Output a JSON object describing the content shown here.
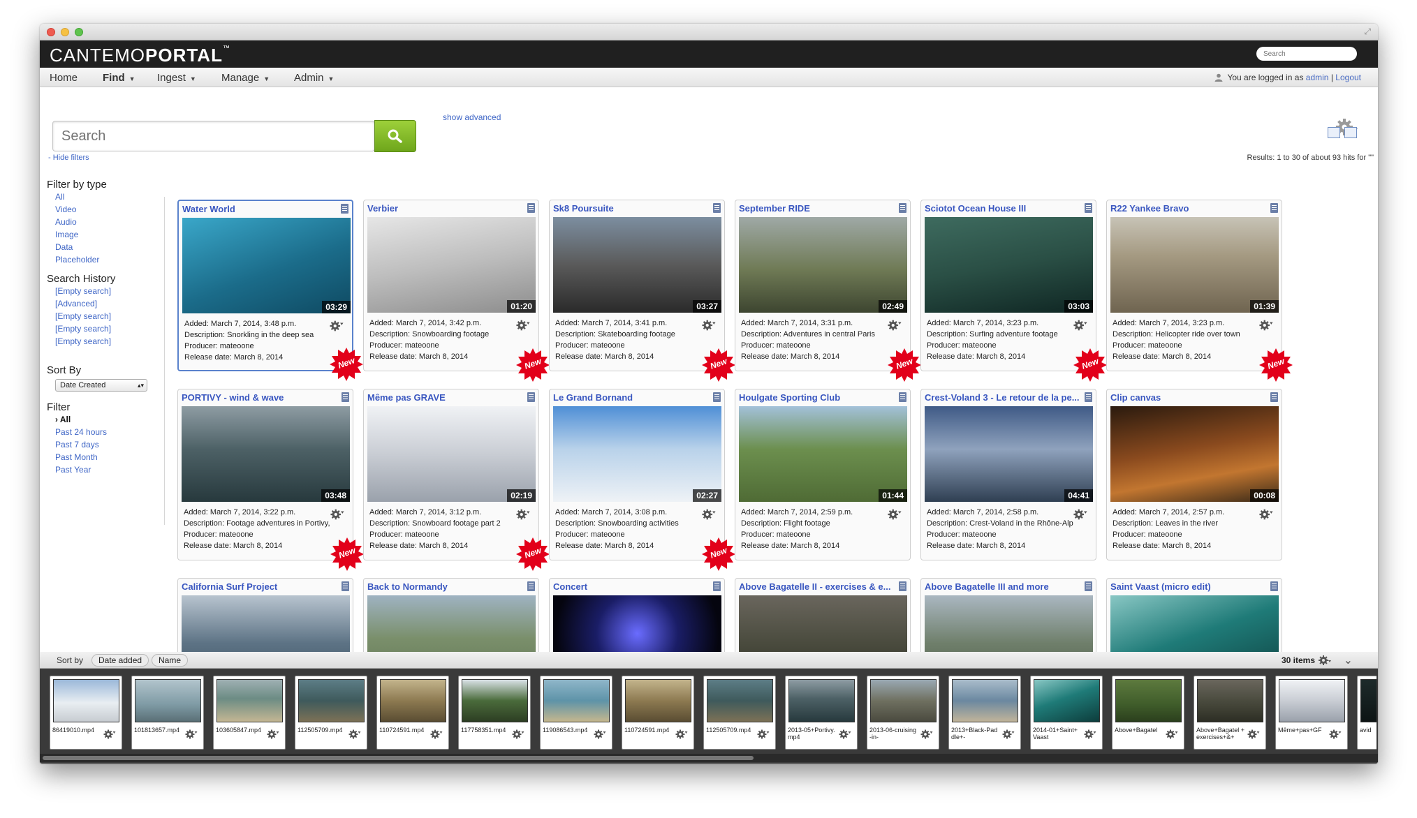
{
  "app": {
    "brand_light": "CANTEMO",
    "brand_bold": "PORTAL",
    "tm": "™",
    "top_search_placeholder": "Search"
  },
  "nav": {
    "items": [
      {
        "label": "Home",
        "caret": false
      },
      {
        "label": "Find",
        "caret": true
      },
      {
        "label": "Ingest",
        "caret": true
      },
      {
        "label": "Manage",
        "caret": true
      },
      {
        "label": "Admin",
        "caret": true
      }
    ],
    "login_prefix": "You are logged in as",
    "user": "admin",
    "separator": "|",
    "logout": "Logout"
  },
  "search": {
    "placeholder": "Search",
    "show_advanced": "show advanced"
  },
  "toolbar": {
    "hide_filters": "- Hide filters",
    "results": "Results: 1 to 30 of about 93 hits for \"\""
  },
  "sidebar": {
    "filter_type_title": "Filter by type",
    "types": [
      "All",
      "Video",
      "Audio",
      "Image",
      "Data",
      "Placeholder"
    ],
    "history_title": "Search History",
    "history": [
      "[Empty search]",
      "[Advanced]",
      "[Empty search]",
      "[Empty search]",
      "[Empty search]"
    ],
    "sort_title": "Sort By",
    "sort_value": "Date Created",
    "filter_title": "Filter",
    "filters": [
      "› All",
      "Past 24 hours",
      "Past 7 days",
      "Past Month",
      "Past Year"
    ]
  },
  "cards": [
    {
      "title": "Water World",
      "duration": "03:29",
      "added": "Added: March 7, 2014, 3:48 p.m.",
      "description": "Description: Snorkling in the deep sea",
      "producer": "Producer: mateoone",
      "release": "Release date: March 8, 2014",
      "new": true,
      "selected": true,
      "bg": "linear-gradient(160deg,#3aa7c9,#1b6c8a 55%,#0f4a62)"
    },
    {
      "title": "Verbier",
      "duration": "01:20",
      "added": "Added: March 7, 2014, 3:42 p.m.",
      "description": "Description: Snowboarding footage",
      "producer": "Producer: mateoone",
      "release": "Release date: March 8, 2014",
      "new": true,
      "selected": false,
      "bg": "linear-gradient(170deg,#e6e6e6,#bdbdbd 50%,#8d8d8d)"
    },
    {
      "title": "Sk8 Poursuite",
      "duration": "03:27",
      "added": "Added: March 7, 2014, 3:41 p.m.",
      "description": "Description: Skateboarding footage",
      "producer": "Producer: mateoone",
      "release": "Release date: March 8, 2014",
      "new": true,
      "selected": false,
      "bg": "linear-gradient(180deg,#7c8ea0,#5a5a5a 50%,#2a2a2a)"
    },
    {
      "title": "September RIDE",
      "duration": "02:49",
      "added": "Added: March 7, 2014, 3:31 p.m.",
      "description": "Description: Adventures in central Paris",
      "producer": "Producer: mateoone",
      "release": "Release date: March 8, 2014",
      "new": true,
      "selected": false,
      "bg": "linear-gradient(180deg,#9fa9a6,#6f7a55 55%,#3d4530)"
    },
    {
      "title": "Sciotot Ocean House III",
      "duration": "03:03",
      "added": "Added: March 7, 2014, 3:23 p.m.",
      "description": "Description: Surfing adventure footage",
      "producer": "Producer: mateoone",
      "release": "Release date: March 8, 2014",
      "new": true,
      "selected": false,
      "bg": "linear-gradient(170deg,#3e6b5f,#2a4f45 50%,#0f2623)"
    },
    {
      "title": "R22 Yankee Bravo",
      "duration": "01:39",
      "added": "Added: March 7, 2014, 3:23 p.m.",
      "description": "Description: Helicopter ride over town",
      "producer": "Producer: mateoone",
      "release": "Release date: March 8, 2014",
      "new": true,
      "selected": false,
      "bg": "linear-gradient(180deg,#c7c3b6,#a59a82 40%,#6f6450)"
    },
    {
      "title": "PORTIVY - wind & wave",
      "duration": "03:48",
      "added": "Added: March 7, 2014, 3:22 p.m.",
      "description": "Description: Footage adventures in Portivy,",
      "producer": "Producer: mateoone",
      "release": "Release date: March 8, 2014",
      "new": true,
      "selected": false,
      "bg": "linear-gradient(180deg,#8e9ca3,#4d6166 45%,#27393d)"
    },
    {
      "title": "Même pas GRAVE",
      "duration": "02:19",
      "added": "Added: March 7, 2014, 3:12 p.m.",
      "description": "Description: Snowboard footage part 2",
      "producer": "Producer: mateoone",
      "release": "Release date: March 8, 2014",
      "new": true,
      "selected": false,
      "bg": "linear-gradient(180deg,#f0f2f5,#c9cdd4 50%,#9aa1ab)"
    },
    {
      "title": "Le Grand Bornand",
      "duration": "02:27",
      "added": "Added: March 7, 2014, 3:08 p.m.",
      "description": "Description: Snowboarding activities",
      "producer": "Producer: mateoone",
      "release": "Release date: March 8, 2014",
      "new": true,
      "selected": false,
      "bg": "linear-gradient(180deg,#4f8fd6,#b9d2ea 45%,#eef2f6)"
    },
    {
      "title": "Houlgate Sporting Club",
      "duration": "01:44",
      "added": "Added: March 7, 2014, 2:59 p.m.",
      "description": "Description: Flight footage",
      "producer": "Producer: mateoone",
      "release": "Release date: March 8, 2014",
      "new": false,
      "selected": false,
      "bg": "linear-gradient(180deg,#a3c1d9,#6c8f4e 45%,#4f6b35)"
    },
    {
      "title": "Crest-Voland 3 - Le retour de la pe...",
      "duration": "04:41",
      "added": "Added: March 7, 2014, 2:58 p.m.",
      "description": "Description: Crest-Voland in the Rhône-Alp",
      "producer": "Producer: mateoone",
      "release": "Release date: March 8, 2014",
      "new": false,
      "selected": false,
      "bg": "linear-gradient(180deg,#3f5a86,#8fa2bd 45%,#2f3f52)"
    },
    {
      "title": "Clip canvas",
      "duration": "00:08",
      "added": "Added: March 7, 2014, 2:57 p.m.",
      "description": "Description: Leaves in the river",
      "producer": "Producer: mateoone",
      "release": "Release date: March 8, 2014",
      "new": false,
      "selected": false,
      "bg": "linear-gradient(170deg,#2a1a0e,#8a4a1e 45%,#c27630 70%,#3a2a18)"
    },
    {
      "title": "California Surf Project",
      "duration": "",
      "added": "",
      "description": "",
      "producer": "",
      "release": "",
      "new": false,
      "selected": false,
      "bg": "linear-gradient(180deg,#b8c4cf,#5d7385 50%,#3b4e5e)"
    },
    {
      "title": "Back to Normandy",
      "duration": "",
      "added": "",
      "description": "",
      "producer": "",
      "release": "",
      "new": false,
      "selected": false,
      "bg": "linear-gradient(180deg,#9fb3c2,#7a8f6b 45%,#5f7452)"
    },
    {
      "title": "Concert",
      "duration": "",
      "added": "",
      "description": "",
      "producer": "",
      "release": "",
      "new": false,
      "selected": false,
      "bg": "radial-gradient(circle at 50% 40%,#6a6cff,#1a1d66 40%,#05050f 80%)"
    },
    {
      "title": "Above Bagatelle II - exercises & e...",
      "duration": "",
      "added": "",
      "description": "",
      "producer": "",
      "release": "",
      "new": false,
      "selected": false,
      "bg": "linear-gradient(180deg,#6a665d,#4a4b3e 50%,#2d2e24)"
    },
    {
      "title": "Above Bagatelle III and more",
      "duration": "",
      "added": "",
      "description": "",
      "producer": "",
      "release": "",
      "new": false,
      "selected": false,
      "bg": "linear-gradient(180deg,#aab7c1,#6f7f6b 50%,#4d5a48)"
    },
    {
      "title": "Saint Vaast (micro edit)",
      "duration": "",
      "added": "",
      "description": "",
      "producer": "",
      "release": "",
      "new": false,
      "selected": false,
      "bg": "linear-gradient(160deg,#89c7c4,#1f7b78 45%,#0d3d3c)"
    }
  ],
  "basket": {
    "sort_by": "Sort by",
    "sort_options": [
      "Date added",
      "Name"
    ],
    "count": "30 items",
    "items": [
      {
        "name": "86419010.mp4",
        "bg": "linear-gradient(180deg,#9bb8d9,#e9eef2 55%,#c7ccd1)"
      },
      {
        "name": "101813657.mp4",
        "bg": "linear-gradient(180deg,#b2c4cc,#7e9aa4 60%,#5a6f76)"
      },
      {
        "name": "103605847.mp4",
        "bg": "linear-gradient(180deg,#9fb0b3,#6c8c84 45%,#c4b693)"
      },
      {
        "name": "112505709.mp4",
        "bg": "linear-gradient(180deg,#5d7d86,#3f5a5c 50%,#7c7156)"
      },
      {
        "name": "110724591.mp4",
        "bg": "linear-gradient(180deg,#c3b48c,#8d7a51 50%,#5a4d33)"
      },
      {
        "name": "117758351.mp4",
        "bg": "linear-gradient(180deg,#d9e1e6,#4a6b3b 50%,#2d3e23)"
      },
      {
        "name": "119086543.mp4",
        "bg": "linear-gradient(180deg,#8fb6c9,#5e93a8 50%,#c5b78e)"
      },
      {
        "name": "110724591.mp4",
        "bg": "linear-gradient(180deg,#c3b48c,#8d7a51 50%,#5a4d33)"
      },
      {
        "name": "112505709.mp4",
        "bg": "linear-gradient(180deg,#5d7d86,#3f5a5c 50%,#7c7156)"
      },
      {
        "name": "2013-05+Portivy.mp4",
        "bg": "linear-gradient(180deg,#8e9ca3,#4d6166 45%,#27393d)"
      },
      {
        "name": "2013-06-cruising-in-",
        "bg": "linear-gradient(180deg,#9aa9b3,#6f7060 50%,#4a4a3f)"
      },
      {
        "name": "2013+Black-Paddle+-",
        "bg": "linear-gradient(180deg,#a9bccb,#6b88a0 50%,#c1b49a)"
      },
      {
        "name": "2014-01+Saint+Vaast",
        "bg": "linear-gradient(160deg,#89c7c4,#1f7b78 45%,#0d3d3c)"
      },
      {
        "name": "Above+Bagatel",
        "bg": "linear-gradient(180deg,#5d7a3e,#3f5c2a 60%,#2b3f1d)"
      },
      {
        "name": "Above+Bagatel +exercises+&+",
        "bg": "linear-gradient(180deg,#6a665d,#4a4b3e 50%,#2d2e24)"
      },
      {
        "name": "Même+pas+GF",
        "bg": "linear-gradient(180deg,#f0f2f5,#c9cdd4 50%,#9aa1ab)"
      },
      {
        "name": "avid",
        "bg": "linear-gradient(180deg,#1d2a2a,#0d1414)"
      }
    ]
  }
}
